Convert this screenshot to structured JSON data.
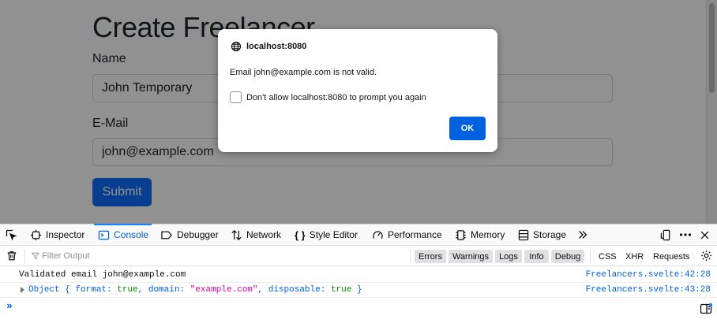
{
  "page": {
    "title": "Create Freelancer",
    "name_label": "Name",
    "name_value": "John Temporary",
    "email_label": "E-Mail",
    "email_value": "john@example.com",
    "submit_label": "Submit"
  },
  "dialog": {
    "origin": "localhost:8080",
    "message": "Email john@example.com is not valid.",
    "checkbox_label": "Don't allow localhost:8080 to prompt you again",
    "checkbox_checked": false,
    "ok_label": "OK"
  },
  "devtools": {
    "tabs": {
      "inspector": "Inspector",
      "console": "Console",
      "debugger": "Debugger",
      "network": "Network",
      "style_editor": "Style Editor",
      "performance": "Performance",
      "memory": "Memory",
      "storage": "Storage"
    },
    "selected_tab": "Console",
    "filter_placeholder": "Filter Output",
    "filters": {
      "errors": "Errors",
      "warnings": "Warnings",
      "logs": "Logs",
      "info": "Info",
      "debug": "Debug",
      "css": "CSS",
      "xhr": "XHR",
      "requests": "Requests"
    },
    "console_log": [
      {
        "message": "Validated email john@example.com",
        "location": "Freelancers.svelte:42:28"
      },
      {
        "object": {
          "prefix": "Object { ",
          "k1": "format:",
          "v1": "true",
          "k2": "domain:",
          "v2": "\"example.com\"",
          "k3": "disposable:",
          "v3": "true",
          "suffix": " }"
        },
        "location": "Freelancers.svelte:43:28"
      }
    ],
    "prompt": "»"
  },
  "colors": {
    "accent": "#0060df",
    "ok_button": "#0061e0",
    "submit_button": "#0d6efd"
  }
}
